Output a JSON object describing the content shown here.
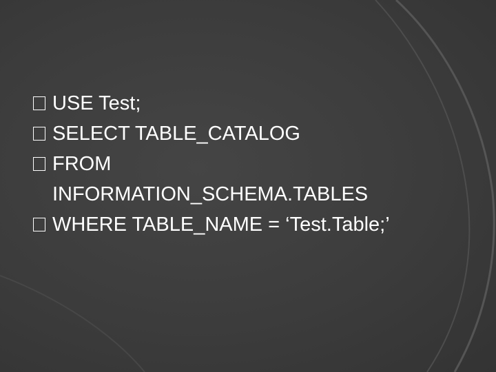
{
  "slide": {
    "lines": [
      {
        "text": "USE Test;",
        "bullet": true
      },
      {
        "text": "SELECT TABLE_CATALOG",
        "bullet": true
      },
      {
        "text": "FROM",
        "bullet": true
      },
      {
        "text": "INFORMATION_SCHEMA.TABLES",
        "bullet": false
      },
      {
        "text": "WHERE TABLE_NAME = ‘Test.Table;’",
        "bullet": true
      }
    ]
  },
  "colors": {
    "background": "#3a3a3a",
    "text": "#ffffff",
    "decoration": "#5a5a5a"
  }
}
